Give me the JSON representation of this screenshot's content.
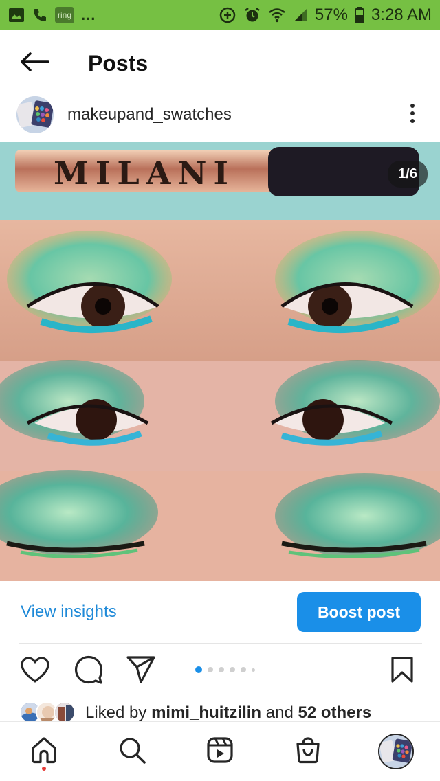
{
  "status_bar": {
    "ring_label": "ring",
    "overflow": "...",
    "battery": "57%",
    "time": "3:28 AM"
  },
  "header": {
    "title": "Posts"
  },
  "post": {
    "username": "makeupand_swatches",
    "media_counter": "1/6",
    "product_brand_text": "MILANI",
    "carousel": {
      "current": 1,
      "total": 6
    }
  },
  "insights": {
    "view_insights_label": "View insights",
    "boost_label": "Boost post"
  },
  "likes": {
    "prefix": "Liked by",
    "user": "mimi_huitzilin",
    "middle": "and",
    "others": "52 others"
  },
  "colors": {
    "status_bar": "#76c043",
    "accent_blue": "#1a8fe8",
    "link_blue": "#1f8ad8",
    "notification_dot": "#e53935"
  },
  "icons": {
    "back": "arrow-left-icon",
    "more": "vertical-dots-icon",
    "like": "heart-icon",
    "comment": "comment-bubble-icon",
    "share": "paper-plane-icon",
    "save": "bookmark-icon",
    "home": "home-icon",
    "search": "search-icon",
    "reels": "reels-icon",
    "shop": "shop-bag-icon"
  }
}
